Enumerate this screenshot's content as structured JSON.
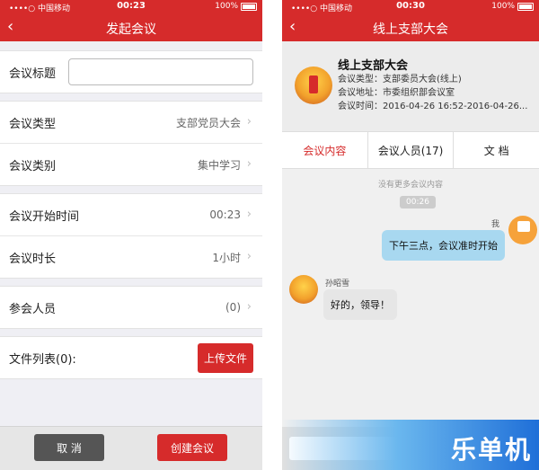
{
  "left": {
    "status": {
      "carrier": "••••○ 中国移动",
      "time": "00:23",
      "battery": "100%"
    },
    "nav": {
      "back": "‹",
      "title": "发起会议"
    },
    "title_row": {
      "label": "会议标题",
      "value": ""
    },
    "type_row": {
      "label": "会议类型",
      "value": "支部党员大会"
    },
    "category_row": {
      "label": "会议类别",
      "value": "集中学习"
    },
    "start_row": {
      "label": "会议开始时间",
      "value": "00:23"
    },
    "duration_row": {
      "label": "会议时长",
      "value": "1小时"
    },
    "attendees_row": {
      "label": "参会人员",
      "value": "(0)"
    },
    "files_row": {
      "label": "文件列表(0):",
      "button": "上传文件"
    },
    "footer": {
      "cancel": "取 消",
      "create": "创建会议"
    }
  },
  "right": {
    "status": {
      "carrier": "••••○ 中国移动",
      "time": "00:30",
      "battery": "100%"
    },
    "nav": {
      "back": "‹",
      "title": "线上支部大会"
    },
    "meeting": {
      "title": "线上支部大会",
      "type": "会议类型：支部委员大会(线上)",
      "location": "会议地址：市委组织部会议室",
      "time": "会议时间：2016-04-26 16:52-2016-04-26..."
    },
    "tabs": [
      "会议内容",
      "会议人员(17)",
      "文 档"
    ],
    "chat": {
      "no_more": "没有更多会议内容",
      "timestamp": "00:26",
      "me_label": "我",
      "me_message": "下午三点，会议准时开始",
      "other_name": "孙昭雪",
      "other_message": "好的，领导！"
    },
    "watermark": "乐单机"
  },
  "colors": {
    "accent": "#d62b2b",
    "bubble_me": "#a8d8f0",
    "bubble_other": "#e6e6e6"
  }
}
